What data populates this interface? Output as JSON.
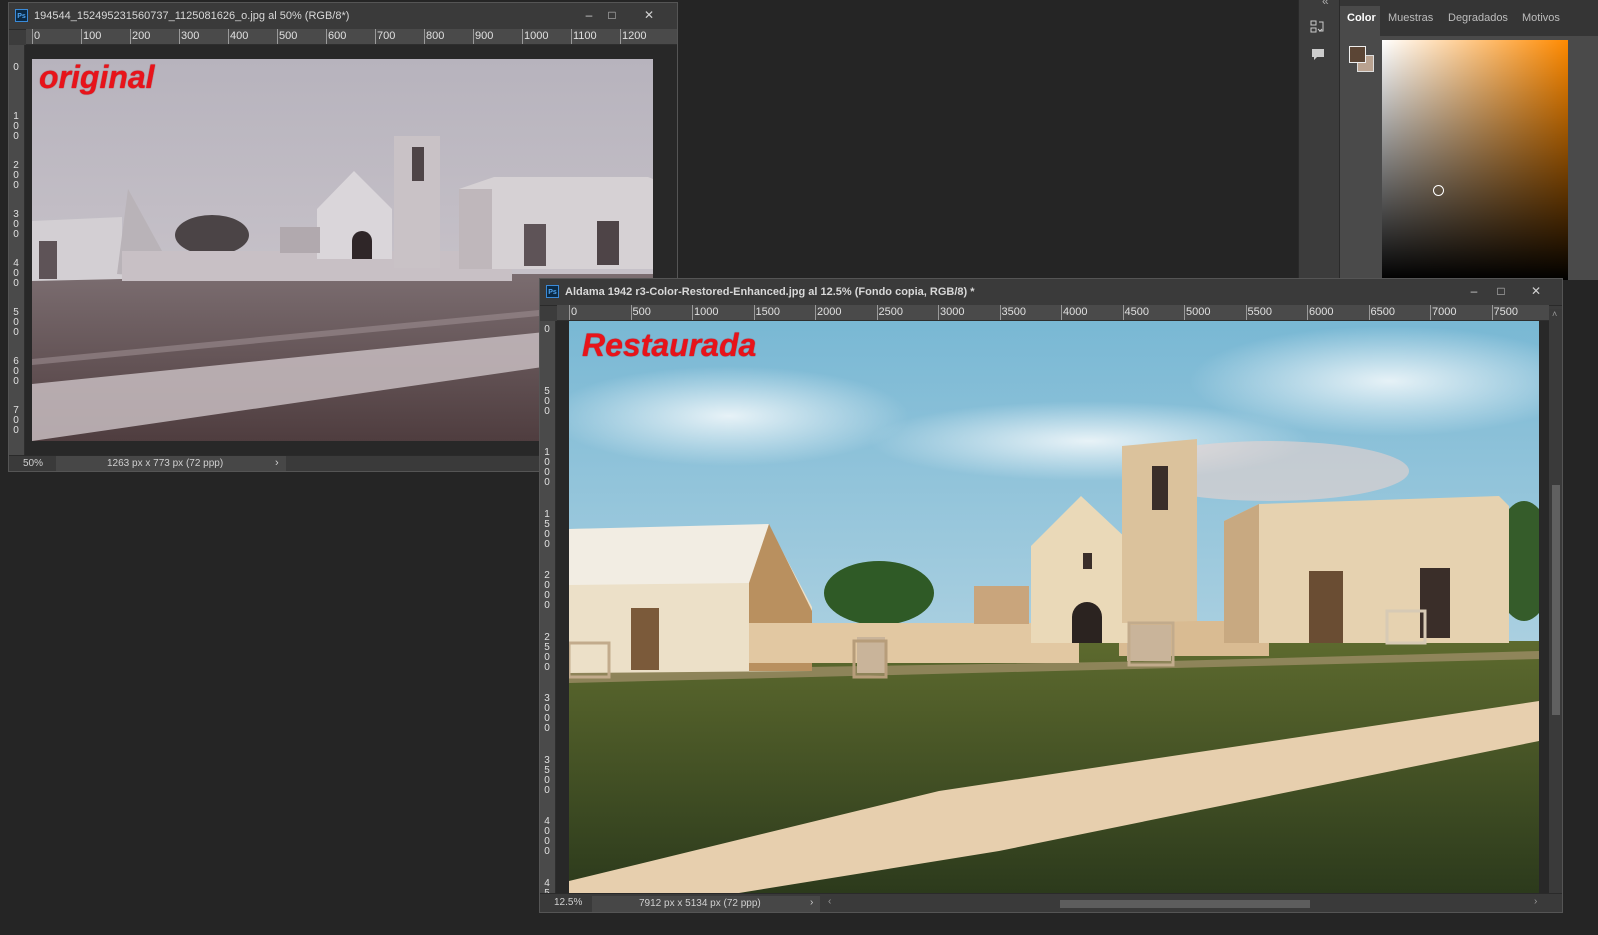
{
  "colors": {
    "app_bg": "#252525",
    "panel_bg": "#3c3c3c",
    "overlay_text": "#e8131a",
    "foreground_color": "#5b4535",
    "background_color": "#b9a290"
  },
  "window1": {
    "title": "194544_152495231560737_1125081626_o.jpg al 50% (RGB/8*)",
    "overlay_label": "original",
    "ruler_h": [
      "0",
      "100",
      "200",
      "300",
      "400",
      "500",
      "600",
      "700",
      "800",
      "900",
      "1000",
      "1100",
      "1200"
    ],
    "ruler_v": [
      "0",
      "1\n0\n0",
      "2\n0\n0",
      "3\n0\n0",
      "4\n0\n0",
      "5\n0\n0",
      "6\n0\n0",
      "7\n0\n0"
    ],
    "zoom": "50%",
    "doc_info": "1263 px x 773 px (72 ppp)",
    "arrow_icon": "chevron-right-icon"
  },
  "window2": {
    "title": "Aldama 1942 r3-Color-Restored-Enhanced.jpg al 12.5% (Fondo copia, RGB/8) *",
    "overlay_label": "Restaurada",
    "ruler_h": [
      "0",
      "500",
      "1000",
      "1500",
      "2000",
      "2500",
      "3000",
      "3500",
      "4000",
      "4500",
      "5000",
      "5500",
      "6000",
      "6500",
      "7000",
      "7500"
    ],
    "ruler_v": [
      "0",
      "5\n0\n0",
      "1\n0\n0\n0",
      "1\n5\n0\n0",
      "2\n0\n0\n0",
      "2\n5\n0\n0",
      "3\n0\n0\n0",
      "3\n5\n0\n0",
      "4\n0\n0\n0",
      "4\n5"
    ],
    "zoom": "12.5%",
    "doc_info": "7912 px x 5134 px (72 ppp)"
  },
  "window_controls": {
    "minimize": "–",
    "maximize": "□",
    "close": "✕"
  },
  "right_panel": {
    "tabs": [
      "Color",
      "Muestras",
      "Degradados",
      "Motivos"
    ],
    "active_tab": "Color",
    "collapse_glyph": "«"
  }
}
